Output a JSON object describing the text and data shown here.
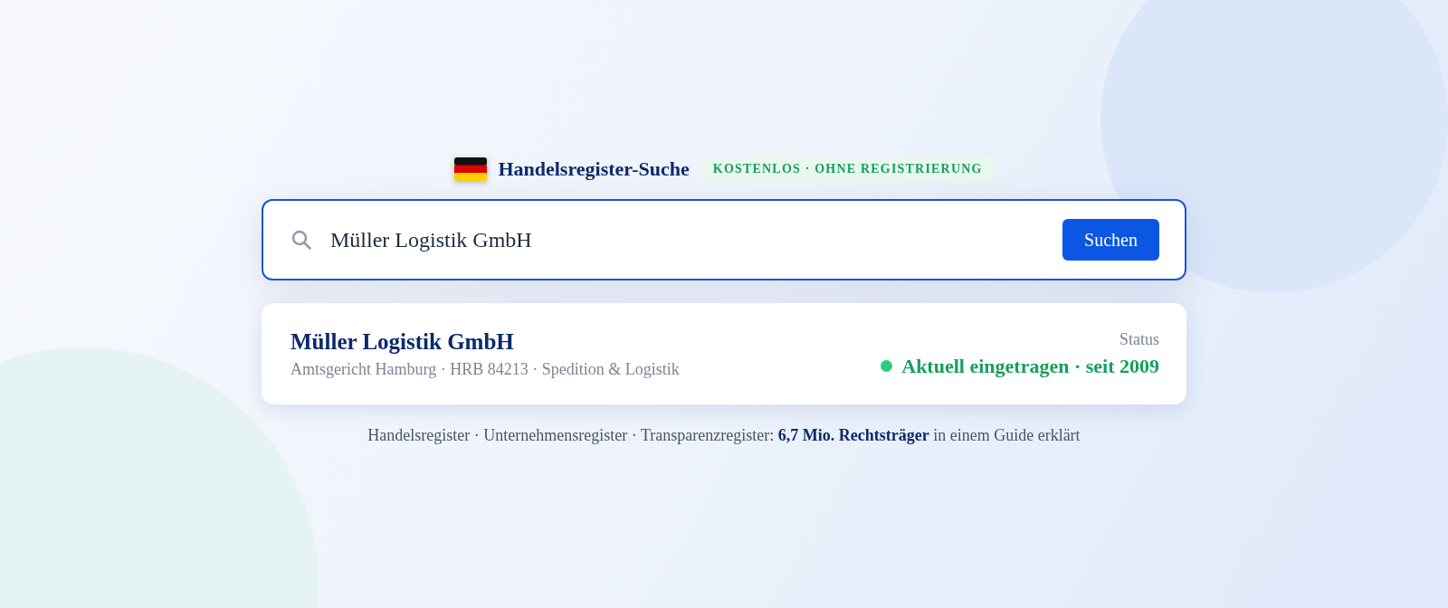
{
  "header": {
    "title": "Handelsregister-Suche",
    "badge": "KOSTENLOS · OHNE REGISTRIERUNG"
  },
  "search": {
    "value": "Müller Logistik GmbH",
    "button": "Suchen"
  },
  "result": {
    "name": "Müller Logistik GmbH",
    "details": "Amtsgericht Hamburg · HRB 84213 · Spedition & Logistik",
    "status_label": "Status",
    "status": "Aktuell eingetragen · seit 2009"
  },
  "footer": "Handelsregister · Unternehmensregister · Transparenzregister: **6,7 Mio. Rechtsträger** in einem Guide erklärt"
}
